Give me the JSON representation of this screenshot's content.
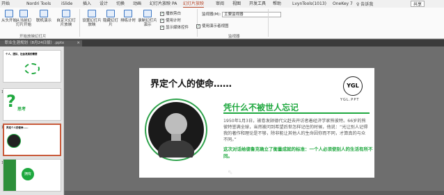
{
  "tabs": [
    "开始",
    "Nordri Tools",
    "iSlide",
    "插入",
    "设计",
    "切换",
    "动画",
    "幻灯片放映",
    "PA",
    "审阅",
    "视图",
    "开发工具",
    "帮助",
    "LvynTools(1013)",
    "OneKey 7"
  ],
  "active_tab": "幻灯片放映",
  "search": "♀ 告诉我",
  "share": "共享",
  "ribbon": {
    "start_group": {
      "b1": "从头开始",
      "b2": "从当前幻灯片开始",
      "b3": "联机演示",
      "b4": "自定义幻灯片放映",
      "label": "开始放映幻灯片"
    },
    "setup_group": {
      "b1": "设置幻灯片放映",
      "b2": "隐藏幻灯片",
      "b3": "排练计时",
      "b4": "录制幻灯片演示",
      "c1": "播放旁白",
      "c2": "使用计时",
      "c3": "显示媒体控件"
    },
    "monitor_group": {
      "monitor_label": "监视器(M):",
      "monitor_value": "主要监视器",
      "presenter": "使用演示者视图",
      "label": "监视器"
    }
  },
  "file_tab": "职业生涯规划（8月24日版）.pptx",
  "file_close": "×",
  "thumbs": [
    {
      "n": "",
      "title": "个人、团队、社会发展的需要"
    },
    {
      "n": "11",
      "title": "思考"
    },
    {
      "n": "12",
      "title": "界定个人的使命……"
    },
    {
      "n": "13",
      "title": "拥有"
    },
    {
      "n": "14",
      "title": ""
    }
  ],
  "slide": {
    "title": "界定个人的使命……",
    "logo": "YGL",
    "logo_text": "YGL.PPT",
    "heading": "凭什么不被世人忘记",
    "body": "1950年1月3日，被卷发顾德代父赶去开访者着经济学家熊彼特。66岁的熊彼特誉满全球，当然被问到希望后世怎样记住的时候，他说：“光让别人记得我的著作和理论是不够，除非能让其他人的生命因你而不同，才算真的与众不同。”",
    "quote": "这次对话给德鲁克确立了衡量成就的标准：一个人必须使别人的生活有所不同。"
  }
}
